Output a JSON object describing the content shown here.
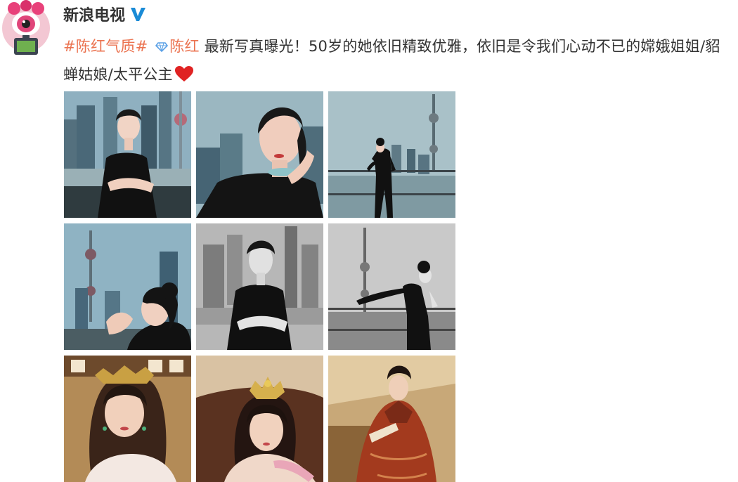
{
  "account": {
    "name": "新浪电视",
    "avatar_icon": "pink-eye-mascot-icon",
    "verified_icon": "verified-v-icon",
    "verified_color": "#1a8bd6"
  },
  "post": {
    "hashtag": "#陈红气质#",
    "mention_icon": "diamond-icon",
    "mention": "陈红",
    "body": " 最新写真曝光！50岁的她依旧精致优雅，依旧是令我们心动不已的嫦娥姐姐/貂蝉姑娘/太平公主",
    "emoji_icon": "red-heart-icon",
    "link_color": "#eb7350"
  },
  "photos": [
    {
      "name": "photo-1",
      "alt": "skyline portrait arms crossed"
    },
    {
      "name": "photo-2",
      "alt": "close-up hand on chin"
    },
    {
      "name": "photo-3",
      "alt": "pose by railing with tower"
    },
    {
      "name": "photo-4",
      "alt": "profile with tower"
    },
    {
      "name": "photo-5",
      "alt": "black and white arms crossed"
    },
    {
      "name": "photo-6",
      "alt": "black and white railing pose"
    },
    {
      "name": "photo-7",
      "alt": "costume drama still one"
    },
    {
      "name": "photo-8",
      "alt": "costume drama still two"
    },
    {
      "name": "photo-9",
      "alt": "costume painting red robe"
    }
  ]
}
